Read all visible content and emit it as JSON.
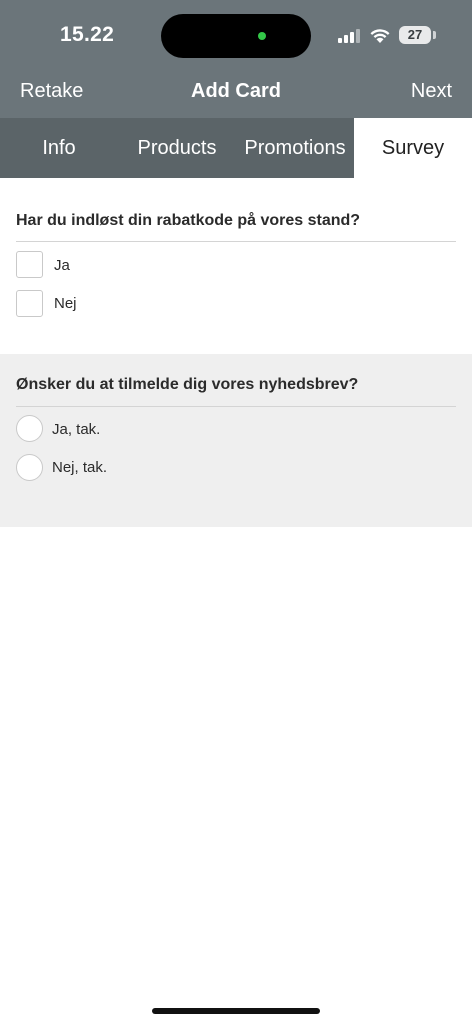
{
  "status": {
    "time": "15.22",
    "battery": "27"
  },
  "nav": {
    "left_label": "Retake",
    "title": "Add Card",
    "right_label": "Next"
  },
  "tabs": [
    {
      "label": "Info",
      "selected": false
    },
    {
      "label": "Products",
      "selected": false
    },
    {
      "label": "Promotions",
      "selected": false
    },
    {
      "label": "Survey",
      "selected": true
    }
  ],
  "survey": {
    "q1": {
      "question": "Har du indløst din rabatkode på vores stand?",
      "options": [
        {
          "label": "Ja",
          "checked": false
        },
        {
          "label": "Nej",
          "checked": false
        }
      ]
    },
    "q2": {
      "question": "Ønsker du at tilmelde dig vores nyhedsbrev?",
      "options": [
        {
          "label": "Ja, tak.",
          "selected": false
        },
        {
          "label": "Nej, tak.",
          "selected": false
        }
      ]
    }
  },
  "colors": {
    "header_bg": "#6b757a",
    "tabs_bg": "#5b6468",
    "section_alt_bg": "#efefef",
    "island_dot": "#33c748"
  }
}
